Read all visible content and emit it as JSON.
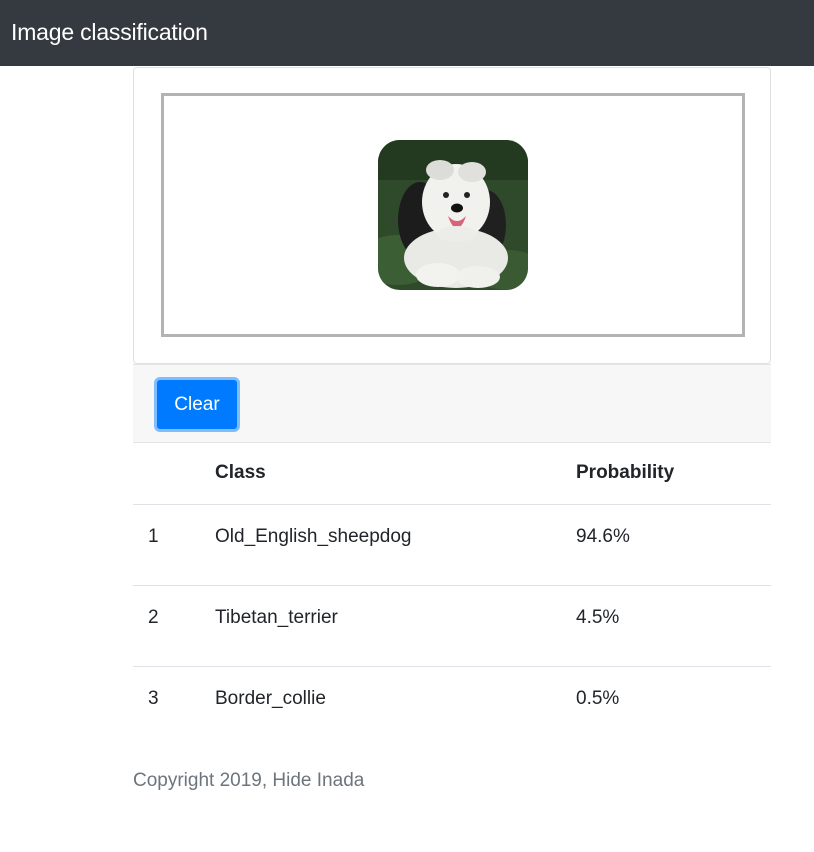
{
  "navbar": {
    "title": "Image classification"
  },
  "upload": {
    "image": "old-english-sheepdog-photo"
  },
  "footer_bar": {
    "clear_label": "Clear"
  },
  "results": {
    "headers": {
      "rank": "",
      "class": "Class",
      "probability": "Probability"
    },
    "rows": [
      {
        "rank": "1",
        "class": "Old_English_sheepdog",
        "probability": "94.6%"
      },
      {
        "rank": "2",
        "class": "Tibetan_terrier",
        "probability": "4.5%"
      },
      {
        "rank": "3",
        "class": "Border_collie",
        "probability": "0.5%"
      }
    ]
  },
  "copyright": "Copyright 2019, Hide Inada",
  "colors": {
    "navbar": "#343a40",
    "button": "#007bff",
    "button_focus": "#80bdff",
    "muted": "#6c757d"
  }
}
